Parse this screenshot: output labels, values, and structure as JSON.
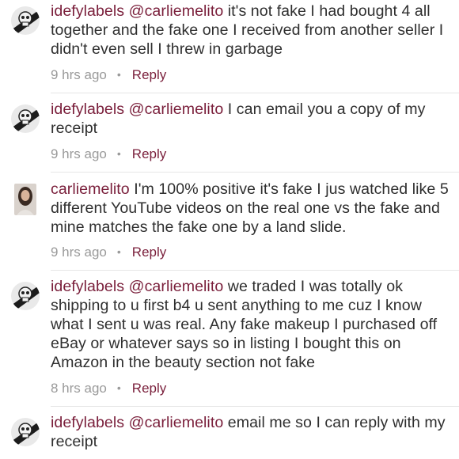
{
  "comments": [
    {
      "user": "idefylabels",
      "mention": "@carliemelito",
      "text": "it's not fake I had bought 4 all together and the fake one I received from another seller I didn't even sell I threw in garbage",
      "time": "9 hrs ago",
      "reply": "Reply"
    },
    {
      "user": "idefylabels",
      "mention": "@carliemelito",
      "text": "I can email you a copy of my receipt",
      "time": "9 hrs ago",
      "reply": "Reply"
    },
    {
      "user": "carliemelito",
      "mention": "",
      "text": "I'm 100% positive it's fake I jus watched like 5 different YouTube videos on the real one vs the fake and mine matches the fake one by a land slide.",
      "time": "9 hrs ago",
      "reply": "Reply"
    },
    {
      "user": "idefylabels",
      "mention": "@carliemelito",
      "text": "we traded I was totally ok shipping to u first b4 u sent anything to me cuz I know what I sent u was real. Any fake makeup I purchased off eBay or whatever says so in listing I bought this on Amazon in the beauty section not fake",
      "time": "8 hrs ago",
      "reply": "Reply"
    },
    {
      "user": "idefylabels",
      "mention": "@carliemelito",
      "text": "email me so I can reply with my receipt",
      "time": "",
      "reply": ""
    }
  ],
  "separator": "•"
}
